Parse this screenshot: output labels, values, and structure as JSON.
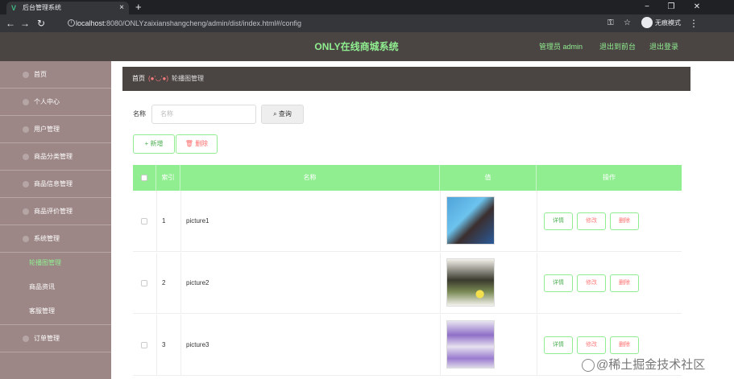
{
  "browser": {
    "tab_title": "后台管理系统",
    "tab_close": "×",
    "new_tab": "+",
    "url_host": "localhost",
    "url_rest": ":8080/ONLYzaixianshangcheng/admin/dist/index.html#/config",
    "incognito_label": "无痕模式"
  },
  "header": {
    "title": "ONLY在线商城系统",
    "admin_label": "管理员 admin",
    "backend_link": "退出到前台",
    "logout_link": "退出登录"
  },
  "sidebar": {
    "items": [
      {
        "label": "首页"
      },
      {
        "label": "个人中心"
      },
      {
        "label": "用户管理"
      },
      {
        "label": "商品分类管理"
      },
      {
        "label": "商品信息管理"
      },
      {
        "label": "商品评价管理"
      },
      {
        "label": "系统管理"
      },
      {
        "label": "轮播图管理"
      },
      {
        "label": "商品资讯"
      },
      {
        "label": "客服管理"
      },
      {
        "label": "订单管理"
      }
    ]
  },
  "breadcrumb": {
    "home": "首页",
    "separator": "(●'◡'●)",
    "current": "轮播图管理"
  },
  "search": {
    "label": "名称",
    "placeholder": "名称",
    "button": "查询"
  },
  "actions": {
    "add": "+ 新增",
    "delete": "删除"
  },
  "table": {
    "headers": [
      "索引",
      "名称",
      "值",
      "操作"
    ],
    "rows": [
      {
        "index": "1",
        "name": "picture1"
      },
      {
        "index": "2",
        "name": "picture2"
      },
      {
        "index": "3",
        "name": "picture3"
      }
    ],
    "op_detail": "详情",
    "op_edit": "修改",
    "op_delete": "删除"
  },
  "watermark": "@稀土掘金技术社区",
  "colors": {
    "accent_green": "#90ee90",
    "header_bg": "#4a4443",
    "sidebar_bg": "#9c8786"
  }
}
